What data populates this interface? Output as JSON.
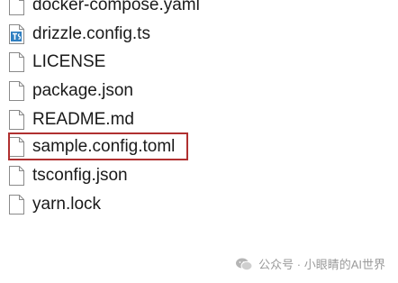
{
  "files": [
    {
      "name": "docker-compose.yaml",
      "icon": "document-icon"
    },
    {
      "name": "drizzle.config.ts",
      "icon": "typescript-file-icon"
    },
    {
      "name": "LICENSE",
      "icon": "document-icon"
    },
    {
      "name": "package.json",
      "icon": "document-icon"
    },
    {
      "name": "README.md",
      "icon": "document-icon"
    },
    {
      "name": "sample.config.toml",
      "icon": "document-icon"
    },
    {
      "name": "tsconfig.json",
      "icon": "document-icon"
    },
    {
      "name": "yarn.lock",
      "icon": "document-icon"
    }
  ],
  "highlight": {
    "file": "sample.config.toml",
    "color": "#b03030"
  },
  "watermark": {
    "text": "公众号 · 小眼睛的AI世界",
    "icon": "wechat-icon"
  }
}
